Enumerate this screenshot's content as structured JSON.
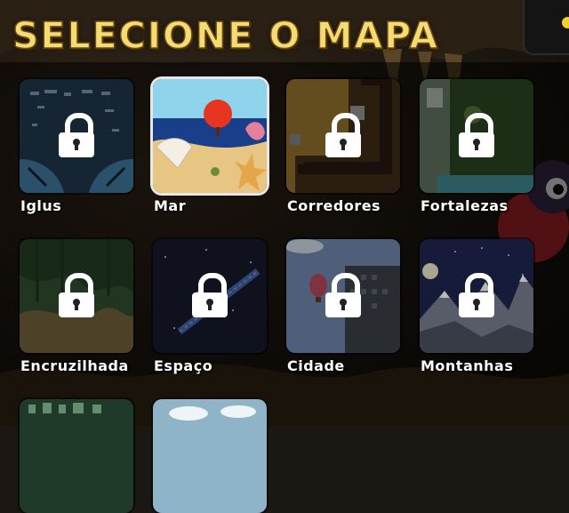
{
  "screen": {
    "title": "SELECIONE O MAPA"
  },
  "maps": [
    {
      "name": "Iglus",
      "locked": true
    },
    {
      "name": "Mar",
      "locked": false
    },
    {
      "name": "Corredores",
      "locked": true
    },
    {
      "name": "Fortalezas",
      "locked": true
    },
    {
      "name": "Encruzilhada",
      "locked": true
    },
    {
      "name": "Espaço",
      "locked": true
    },
    {
      "name": "Cidade",
      "locked": true
    },
    {
      "name": "Montanhas",
      "locked": true
    }
  ],
  "colors": {
    "title": "#f4dc72",
    "title_outline": "#6e4a12",
    "lock": "#ffffff",
    "label": "#ffffff",
    "settings_dot": "#f2cf2a"
  }
}
